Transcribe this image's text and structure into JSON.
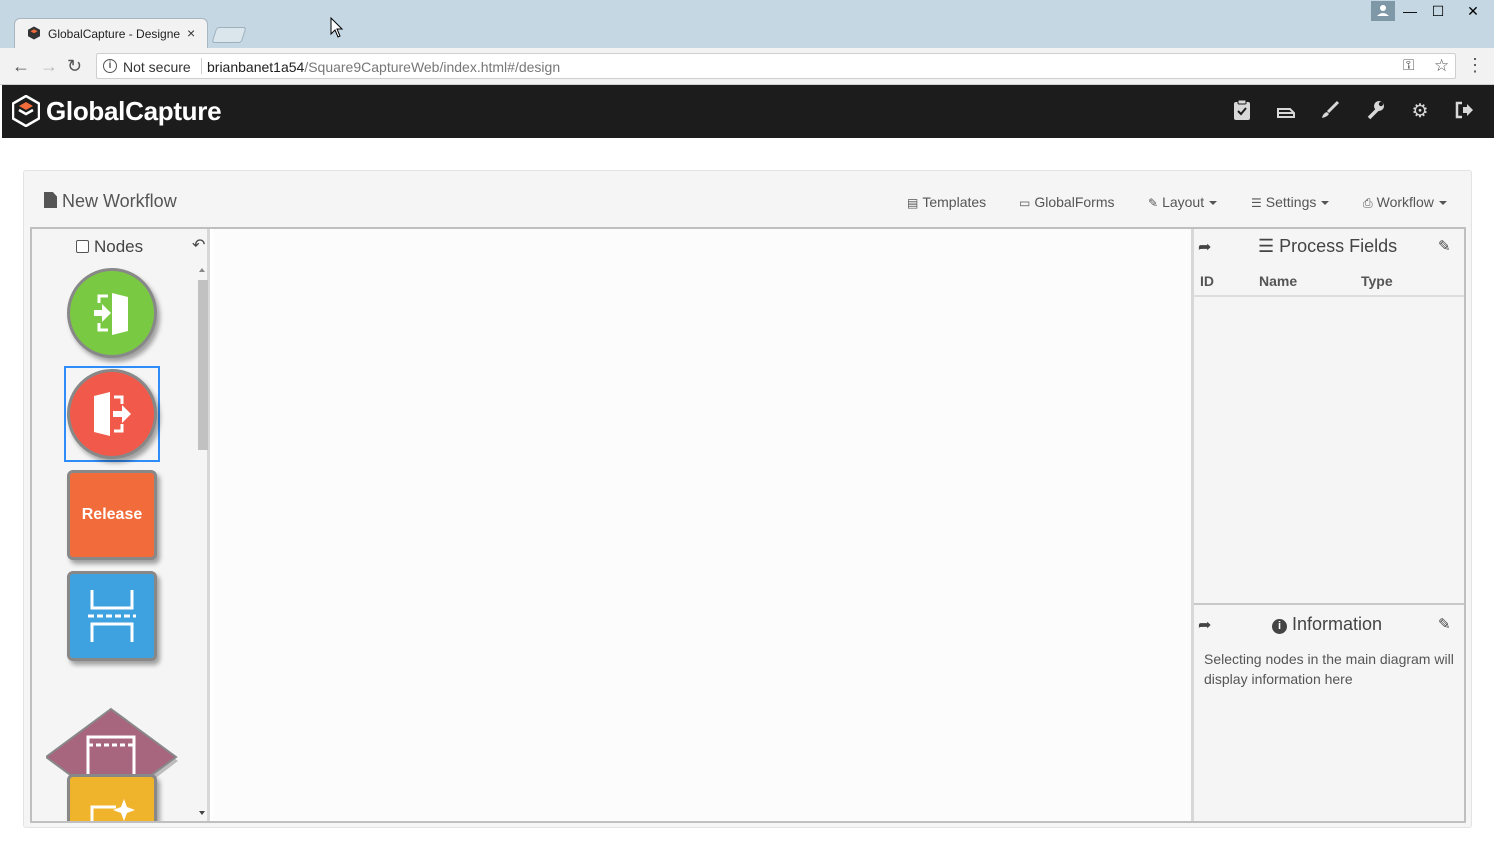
{
  "browser": {
    "tab_title": "GlobalCapture - Designe",
    "tab_close": "×",
    "security_label": "Not secure",
    "url_host": "brianbanet1a54",
    "url_path": "/Square9CaptureWeb/index.html#/design",
    "window_controls": {
      "minimize": "—",
      "maximize": "☐",
      "close": "✕"
    }
  },
  "app": {
    "brand": "GlobalCapture",
    "header_icons": [
      "clipboard-check-icon",
      "scanner-icon",
      "brush-icon",
      "wrench-icon",
      "gear-icon",
      "sign-out-icon"
    ]
  },
  "workflow": {
    "title": "New Workflow",
    "menus": {
      "templates": "Templates",
      "globalforms": "GlobalForms",
      "layout": "Layout",
      "settings": "Settings",
      "workflow": "Workflow"
    }
  },
  "nodes_panel": {
    "title": "Nodes",
    "items": [
      {
        "name": "import-node",
        "shape": "circle",
        "color": "#7ac943"
      },
      {
        "name": "exit-node",
        "shape": "circle",
        "color": "#f15a4a",
        "selected": true
      },
      {
        "name": "release-node",
        "shape": "square",
        "color": "#f26b3a",
        "label": "Release"
      },
      {
        "name": "separator-node",
        "shape": "square",
        "color": "#3fa2e0"
      },
      {
        "name": "form-node",
        "shape": "diamond",
        "color": "#a8657e"
      },
      {
        "name": "extract-node",
        "shape": "square",
        "color": "#f0b32c"
      }
    ]
  },
  "process_fields": {
    "title": "Process Fields",
    "columns": [
      "ID",
      "Name",
      "Type"
    ],
    "rows": []
  },
  "information": {
    "title": "Information",
    "text": "Selecting nodes in the main diagram will display information here"
  }
}
